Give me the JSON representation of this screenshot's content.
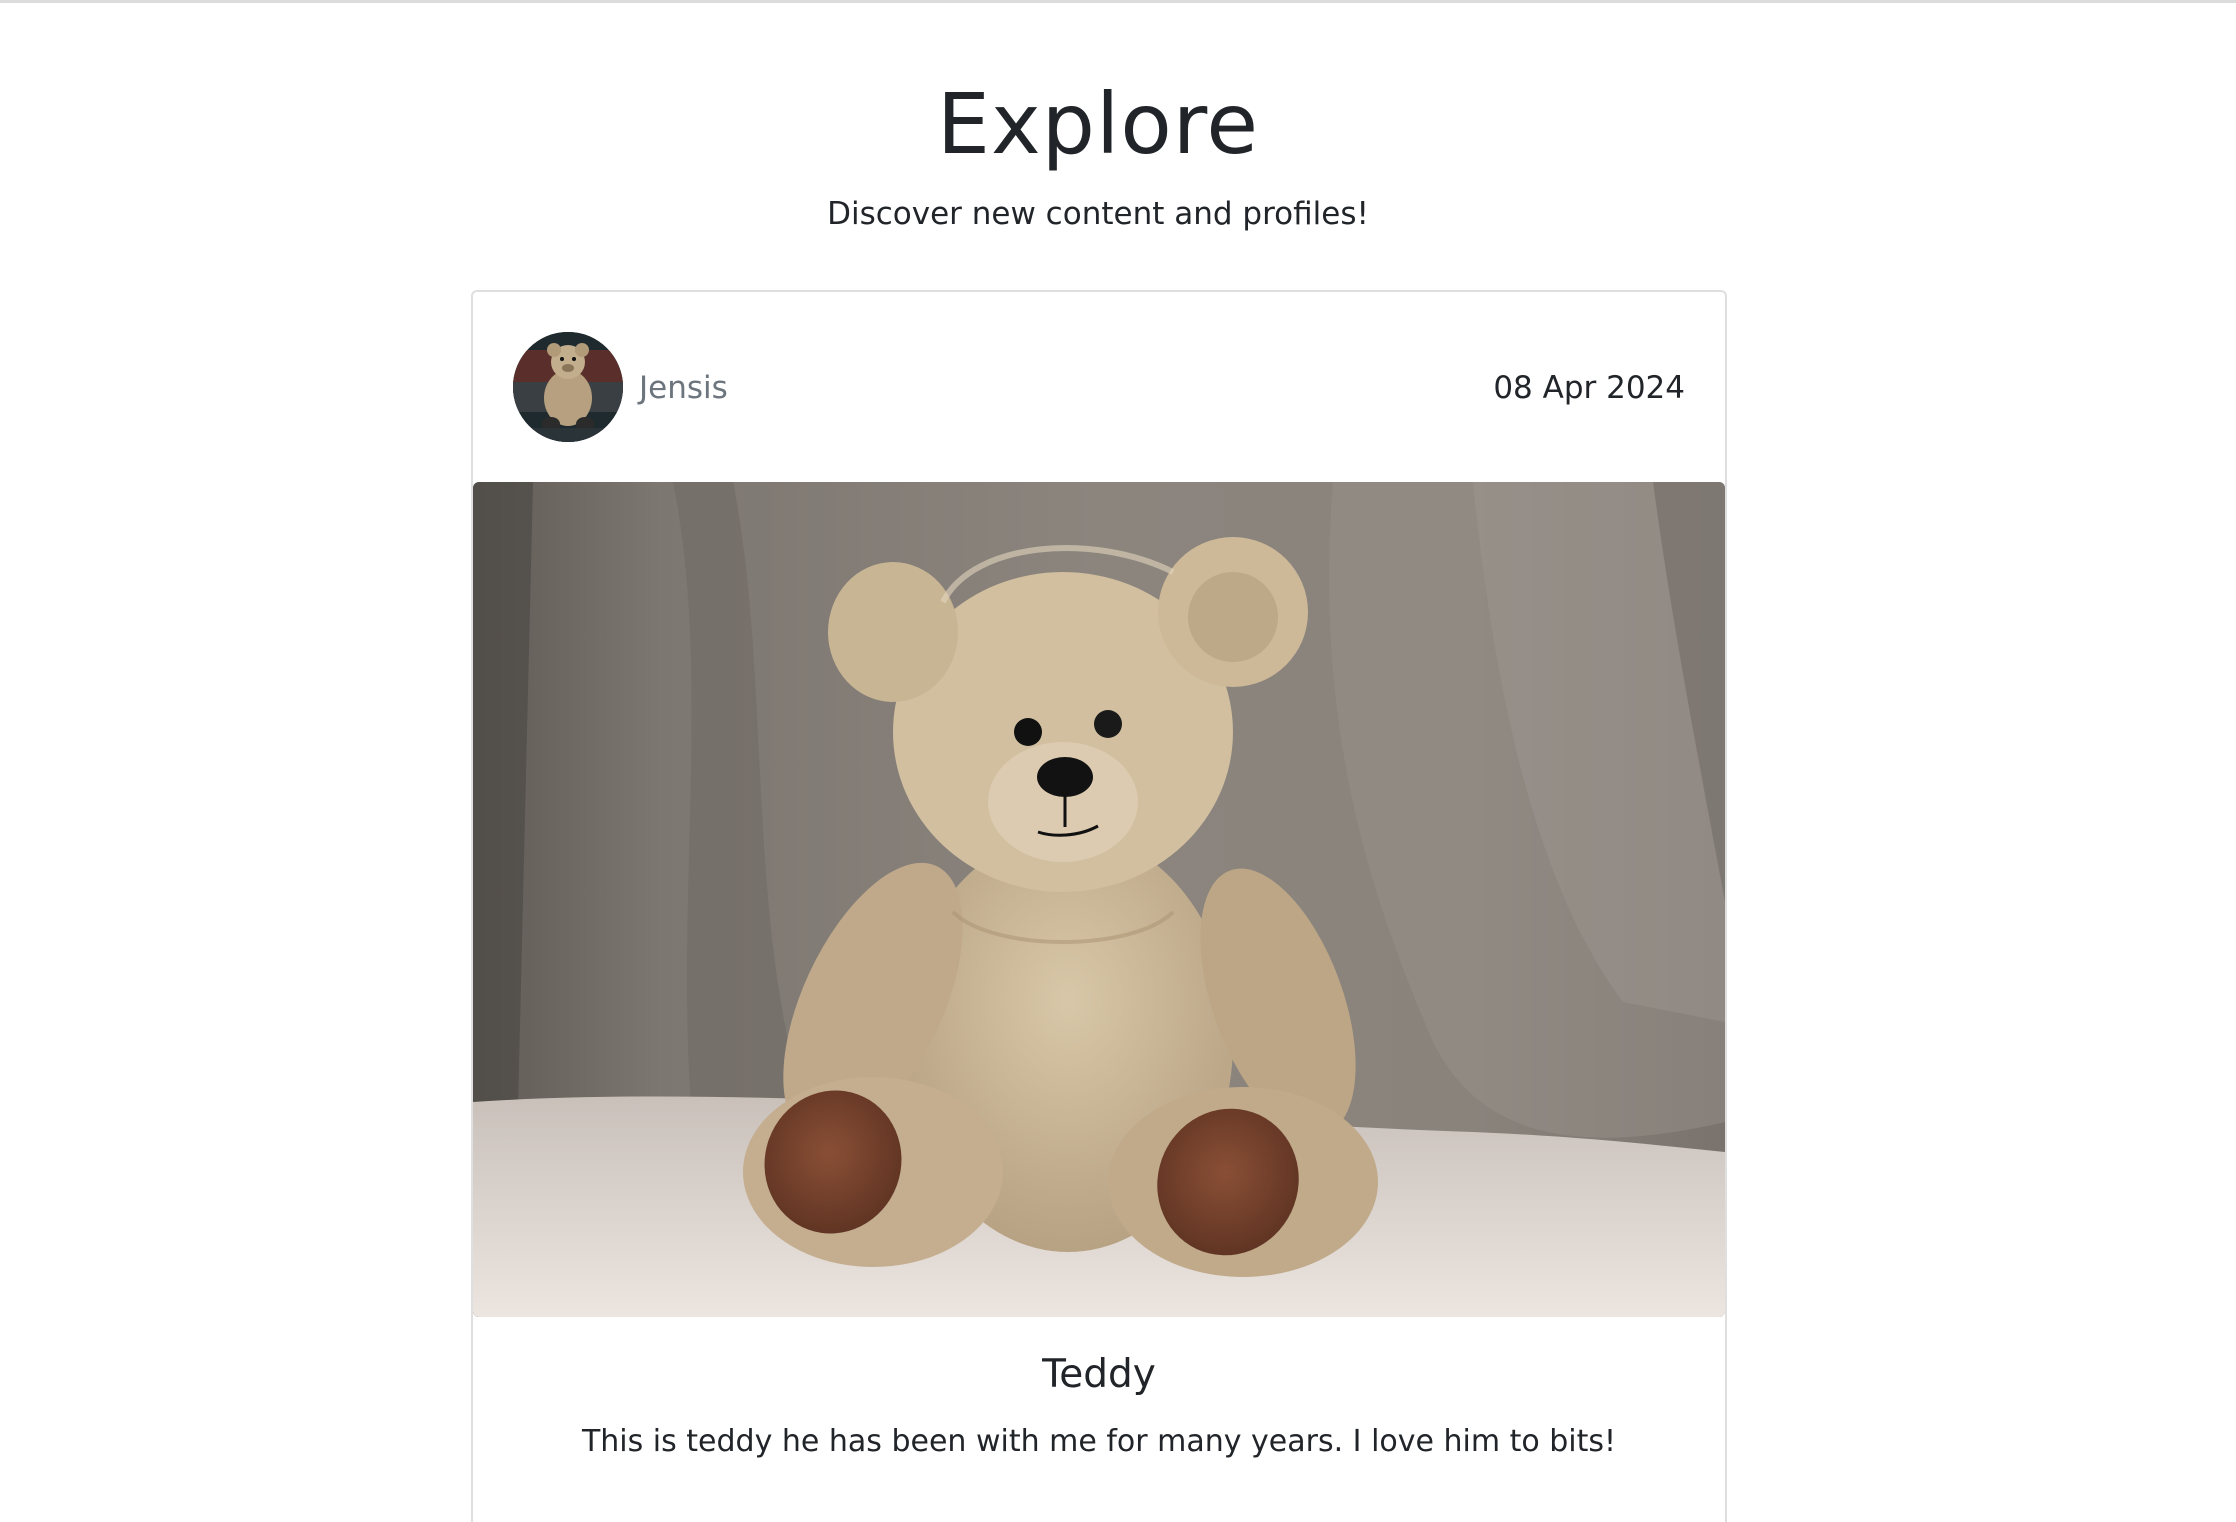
{
  "page": {
    "title": "Explore",
    "subtitle": "Discover new content and profiles!"
  },
  "post": {
    "author": "Jensis",
    "date": "08 Apr 2024",
    "image_icon": "teddy-bear-photo",
    "avatar_icon": "teddy-bear-avatar",
    "title": "Teddy",
    "body": "This is teddy he has been with me for many years. I love him to bits!"
  }
}
